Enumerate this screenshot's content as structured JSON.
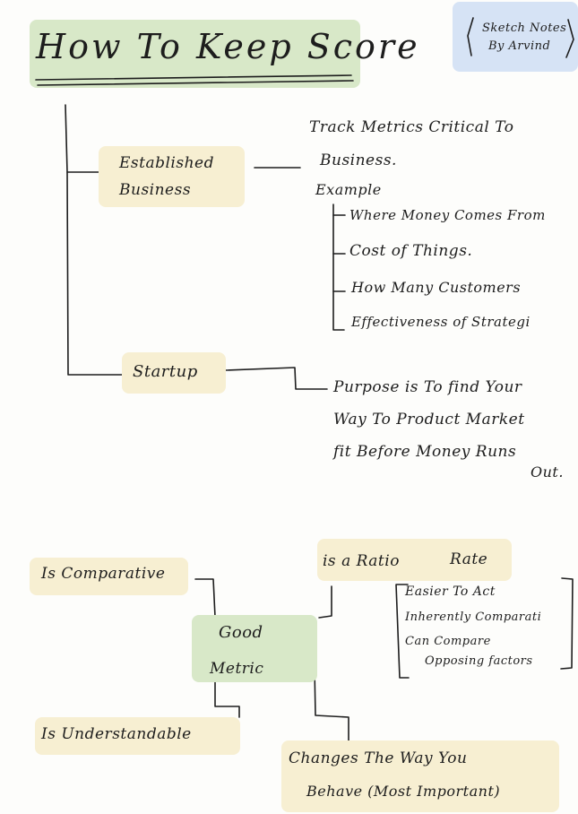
{
  "title": "How To Keep Score",
  "badge": {
    "line1": "Sketch Notes",
    "line2": "By Arvind"
  },
  "established": {
    "label_line1": "Established",
    "label_line2": "Business",
    "text_line1": "Track Metrics Critical To",
    "text_line2": "Business.",
    "example": "Example",
    "items": [
      "Where Money Comes From",
      "Cost of Things.",
      "How Many Customers",
      "Effectiveness of Strategi"
    ]
  },
  "startup": {
    "label": "Startup",
    "text_lines": [
      "Purpose is To find Your",
      "Way To Product Market",
      "fit Before Money Runs",
      "Out."
    ]
  },
  "good_metric": {
    "label_line1": "Good",
    "label_line2": "Metric",
    "comparative": "Is Comparative",
    "ratio": "is a Ratio",
    "rate": "Rate",
    "ratio_items": [
      "Easier To Act",
      "Inherently Comparati",
      "Can Compare",
      "Opposing factors"
    ],
    "understandable": "Is Understandable",
    "changes_line1": "Changes The Way You",
    "changes_line2": "Behave (Most Important)"
  },
  "colors": {
    "green": "#d8e8c8",
    "yellow": "#f7efd2",
    "blue": "#d6e3f5",
    "ink": "#1d1d1d"
  }
}
